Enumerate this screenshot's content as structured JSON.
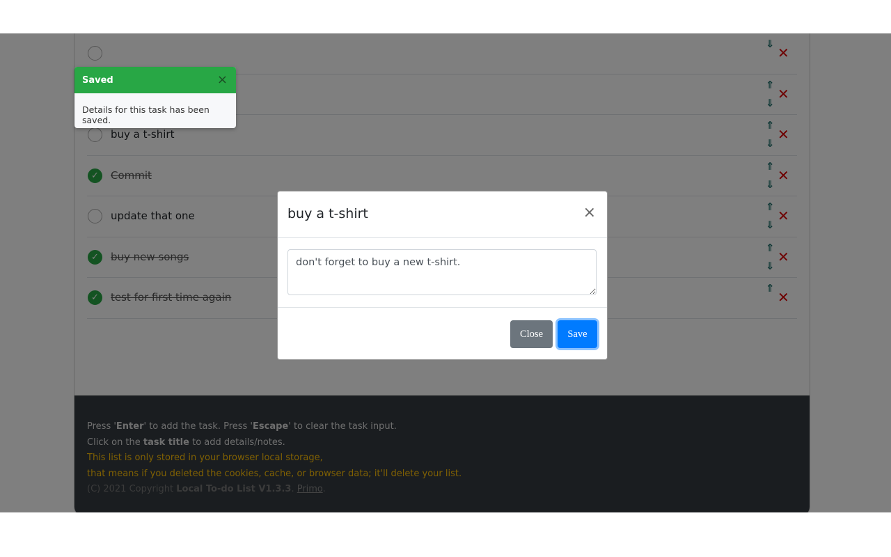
{
  "tasks": [
    {
      "title": "",
      "done": false,
      "up": false,
      "down": true
    },
    {
      "title": "",
      "done": false,
      "up": true,
      "down": true
    },
    {
      "title": "buy a t-shirt",
      "done": false,
      "up": true,
      "down": true
    },
    {
      "title": "Commit",
      "done": true,
      "up": true,
      "down": true
    },
    {
      "title": "update that one",
      "done": false,
      "up": true,
      "down": true
    },
    {
      "title": "buy new songs",
      "done": true,
      "up": true,
      "down": true
    },
    {
      "title": "test for first time again",
      "done": true,
      "up": true,
      "down": false
    }
  ],
  "icons": {
    "up": "⇑",
    "down": "⇓",
    "delete": "✕",
    "check": "✓",
    "close": "×"
  },
  "footer": {
    "l1a": "Press '",
    "l1b": "Enter",
    "l1c": "' to add the task. Press '",
    "l1d": "Escape",
    "l1e": "' to clear the task input.",
    "l2a": "Click on the ",
    "l2b": "task title",
    "l2c": " to add details/notes.",
    "warn1": "This list is only stored in your browser local storage,",
    "warn2": "that means if you deleted the cookies, cache, or browser data; it'll delete your list.",
    "copy": "(C) 2021 Copyright ",
    "app": "Local To-do List V1.3.3",
    "dot": ". ",
    "author": "Primo",
    "end": "."
  },
  "toast": {
    "title": "Saved",
    "close": "×",
    "message": "Details for this task has been saved."
  },
  "modal": {
    "title": "buy a t-shirt",
    "close_icon": "×",
    "notes": "don't forget to buy a new t-shirt.",
    "close_label": "Close",
    "save_label": "Save"
  },
  "colors": {
    "success": "#28a745",
    "primary": "#007bff",
    "secondary": "#6c757d",
    "danger": "#dd0000",
    "warning": "#ffc107",
    "footer": "#343a40"
  }
}
